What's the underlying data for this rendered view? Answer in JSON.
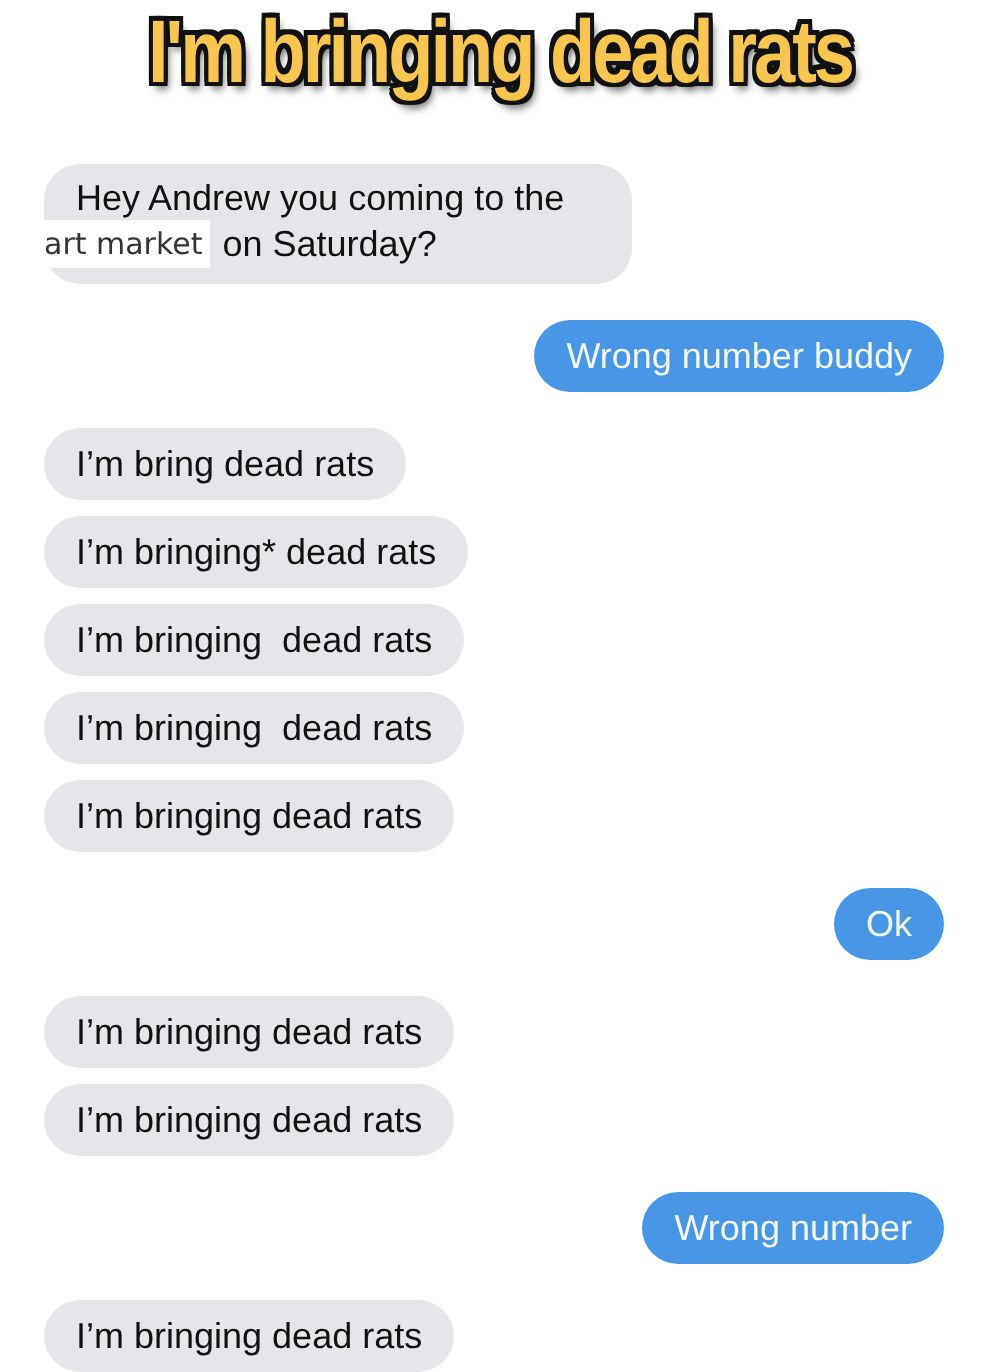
{
  "caption": "I'm bringing dead rats",
  "messages": [
    {
      "kind": "received",
      "text": "Hey Andrew you coming to the",
      "sticker": "art market",
      "text_after": "on Saturday?"
    },
    {
      "kind": "sent",
      "text": "Wrong number buddy"
    },
    {
      "kind": "received",
      "text": "I’m bring dead rats"
    },
    {
      "kind": "received",
      "text": "I’m bringing* dead rats"
    },
    {
      "kind": "received",
      "text": "I’m bringing  dead rats"
    },
    {
      "kind": "received",
      "text": "I’m bringing  dead rats"
    },
    {
      "kind": "received",
      "text": "I’m bringing dead rats"
    },
    {
      "kind": "sent",
      "text": "Ok"
    },
    {
      "kind": "received",
      "text": "I’m bringing dead rats"
    },
    {
      "kind": "received",
      "text": "I’m bringing dead rats"
    },
    {
      "kind": "sent",
      "text": "Wrong number"
    },
    {
      "kind": "received",
      "text": "I’m bringing dead rats"
    }
  ]
}
